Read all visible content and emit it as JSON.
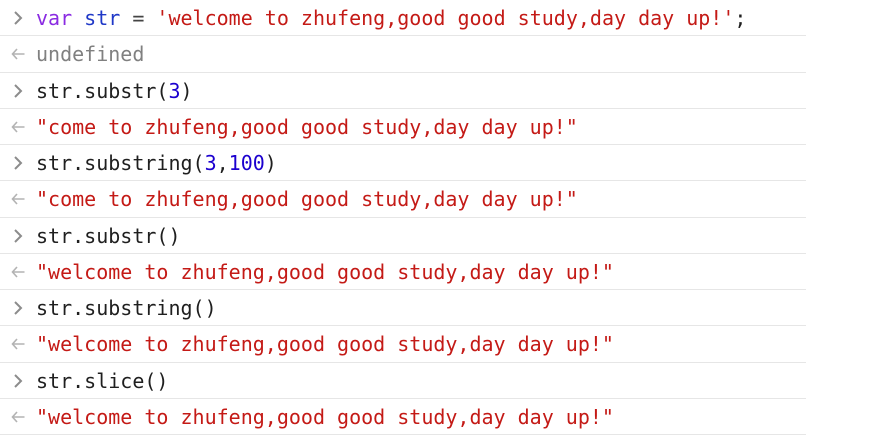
{
  "console": {
    "entries": [
      {
        "type": "input",
        "tokens": [
          {
            "text": "var",
            "cls": "kw"
          },
          {
            "text": " ",
            "cls": "plain"
          },
          {
            "text": "str",
            "cls": "var"
          },
          {
            "text": " = ",
            "cls": "op"
          },
          {
            "text": "'welcome to zhufeng,good good study,day day up!'",
            "cls": "str"
          },
          {
            "text": ";",
            "cls": "plain"
          }
        ]
      },
      {
        "type": "output",
        "tokens": [
          {
            "text": "undefined",
            "cls": "undef"
          }
        ]
      },
      {
        "type": "input",
        "tokens": [
          {
            "text": "str.substr(",
            "cls": "plain"
          },
          {
            "text": "3",
            "cls": "num"
          },
          {
            "text": ")",
            "cls": "plain"
          }
        ]
      },
      {
        "type": "output",
        "tokens": [
          {
            "text": "\"come to zhufeng,good good study,day day up!\"",
            "cls": "result"
          }
        ]
      },
      {
        "type": "input",
        "tokens": [
          {
            "text": "str.substring(",
            "cls": "plain"
          },
          {
            "text": "3",
            "cls": "num"
          },
          {
            "text": ",",
            "cls": "plain"
          },
          {
            "text": "100",
            "cls": "num"
          },
          {
            "text": ")",
            "cls": "plain"
          }
        ]
      },
      {
        "type": "output",
        "tokens": [
          {
            "text": "\"come to zhufeng,good good study,day day up!\"",
            "cls": "result"
          }
        ]
      },
      {
        "type": "input",
        "tokens": [
          {
            "text": "str.substr()",
            "cls": "plain"
          }
        ]
      },
      {
        "type": "output",
        "tokens": [
          {
            "text": "\"welcome to zhufeng,good good study,day day up!\"",
            "cls": "result"
          }
        ]
      },
      {
        "type": "input",
        "tokens": [
          {
            "text": "str.substring()",
            "cls": "plain"
          }
        ]
      },
      {
        "type": "output",
        "tokens": [
          {
            "text": "\"welcome to zhufeng,good good study,day day up!\"",
            "cls": "result"
          }
        ]
      },
      {
        "type": "input",
        "tokens": [
          {
            "text": "str.slice()",
            "cls": "plain"
          }
        ]
      },
      {
        "type": "output",
        "tokens": [
          {
            "text": "\"welcome to zhufeng,good good study,day day up!\"",
            "cls": "result"
          }
        ]
      }
    ]
  },
  "icons": {
    "input": "chevron-right-icon",
    "output": "return-arrow-icon"
  },
  "colors": {
    "keyword": "#8a2be2",
    "variable": "#1f38c7",
    "string": "#c41a16",
    "number": "#1c00cf",
    "undefined": "#808080"
  }
}
